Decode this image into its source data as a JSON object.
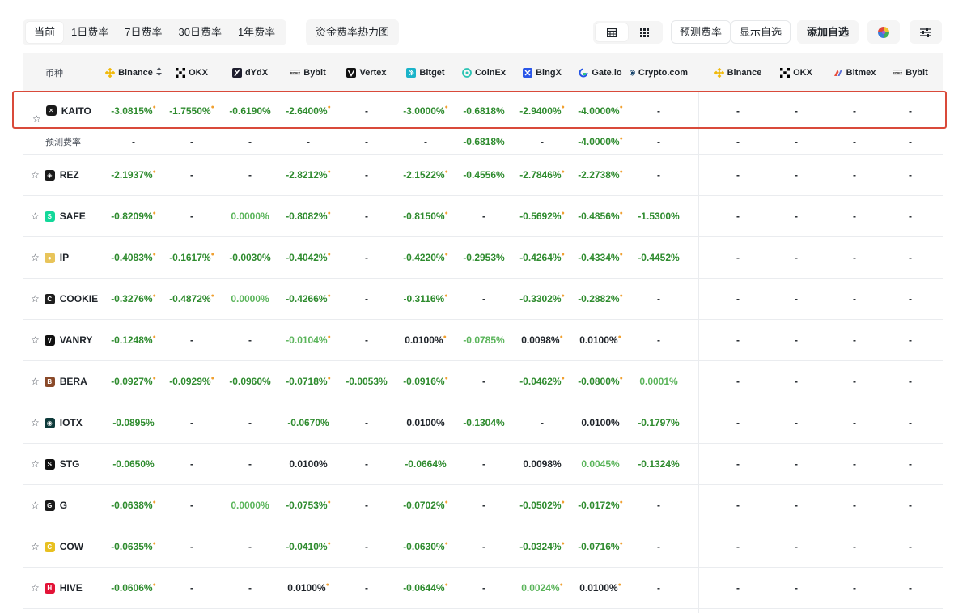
{
  "toolbar": {
    "tabs": [
      {
        "label": "当前",
        "active": true
      },
      {
        "label": "1日费率",
        "active": false
      },
      {
        "label": "7日费率",
        "active": false
      },
      {
        "label": "30日费率",
        "active": false
      },
      {
        "label": "1年费率",
        "active": false
      }
    ],
    "heatmap_label": "资金费率热力图",
    "views": [
      {
        "icon": "table-icon",
        "active": true
      },
      {
        "icon": "grid-icon",
        "active": false
      }
    ],
    "predicted_label": "预测费率",
    "show_watchlist_label": "显示自选",
    "add_watchlist_label": "添加自选",
    "color_icon": "palette-icon",
    "settings_icon": "sliders-icon"
  },
  "colors": {
    "negative": "#2e8b2e",
    "negative_light": "#5ab45a",
    "positive": "#1e2329",
    "dot": "#f0a030",
    "highlight": "#d94a3a",
    "header_bg": "#f5f5f5"
  },
  "table": {
    "coin_header": "币种",
    "exchanges": [
      {
        "name": "Binance",
        "icon": "binance-icon",
        "color": "#f0b90b",
        "sortable": true
      },
      {
        "name": "OKX",
        "icon": "okx-icon",
        "color": "#000000"
      },
      {
        "name": "dYdX",
        "icon": "dydx-icon",
        "color": "#1e1e2e"
      },
      {
        "name": "Bybit",
        "icon": "bybit-icon",
        "color": "#222222"
      },
      {
        "name": "Vertex",
        "icon": "vertex-icon",
        "color": "#111111"
      },
      {
        "name": "Bitget",
        "icon": "bitget-icon",
        "color": "#1ab3c9"
      },
      {
        "name": "CoinEx",
        "icon": "coinex-icon",
        "color": "#2bc4b4"
      },
      {
        "name": "BingX",
        "icon": "bingx-icon",
        "color": "#2a56e8"
      },
      {
        "name": "Gate.io",
        "icon": "gateio-icon",
        "color": "#2354e6"
      },
      {
        "name": "Crypto.com",
        "icon": "cryptocom-icon",
        "color": "#103f68"
      },
      {
        "name": "Binance",
        "icon": "binance-icon",
        "color": "#f0b90b"
      },
      {
        "name": "OKX",
        "icon": "okx-icon",
        "color": "#000000"
      },
      {
        "name": "Bitmex",
        "icon": "bitmex-icon",
        "color": "#e84e3c"
      },
      {
        "name": "Bybit",
        "icon": "bybit-icon",
        "color": "#222222"
      }
    ],
    "rows": [
      {
        "type": "first",
        "coin": "KAITO",
        "logo_color": "#1a1a1a",
        "logo_glyph": "✕",
        "values": [
          "-3.0815%",
          "-1.7550%",
          "-0.6190%",
          "-2.6400%",
          "-",
          "-3.0000%",
          "-0.6818%",
          "-2.9400%",
          "-4.0000%",
          "-",
          "-",
          "-",
          "-",
          "-"
        ],
        "dots": [
          1,
          1,
          0,
          1,
          0,
          1,
          0,
          1,
          1,
          0,
          0,
          0,
          0,
          0
        ],
        "light": [
          0,
          0,
          0,
          0,
          0,
          0,
          0,
          0,
          0,
          0,
          0,
          0,
          0,
          0
        ]
      },
      {
        "type": "pred",
        "label": "预测费率",
        "values": [
          "-",
          "-",
          "-",
          "-",
          "-",
          "-",
          "-0.6818%",
          "-",
          "-4.0000%",
          "-",
          "-",
          "-",
          "-",
          "-"
        ],
        "dots": [
          0,
          0,
          0,
          0,
          0,
          0,
          0,
          0,
          1,
          0,
          0,
          0,
          0,
          0
        ],
        "light": [
          0,
          0,
          0,
          0,
          0,
          0,
          0,
          0,
          0,
          0,
          0,
          0,
          0,
          0
        ]
      },
      {
        "type": "norm",
        "coin": "REZ",
        "logo_color": "#1a1a1a",
        "logo_glyph": "◈",
        "values": [
          "-2.1937%",
          "-",
          "-",
          "-2.8212%",
          "-",
          "-2.1522%",
          "-0.4556%",
          "-2.7846%",
          "-2.2738%",
          "-",
          "-",
          "-",
          "-",
          "-"
        ],
        "dots": [
          1,
          0,
          0,
          1,
          0,
          1,
          0,
          1,
          1,
          0,
          0,
          0,
          0,
          0
        ],
        "light": [
          0,
          0,
          0,
          0,
          0,
          0,
          0,
          0,
          0,
          0,
          0,
          0,
          0,
          0
        ]
      },
      {
        "type": "norm",
        "coin": "SAFE",
        "logo_color": "#12d89a",
        "logo_glyph": "S",
        "values": [
          "-0.8209%",
          "-",
          "0.0000%",
          "-0.8082%",
          "-",
          "-0.8150%",
          "-",
          "-0.5692%",
          "-0.4856%",
          "-1.5300%",
          "-",
          "-",
          "-",
          "-"
        ],
        "dots": [
          1,
          0,
          0,
          1,
          0,
          1,
          0,
          1,
          1,
          0,
          0,
          0,
          0,
          0
        ],
        "light": [
          0,
          0,
          1,
          0,
          0,
          0,
          0,
          0,
          0,
          0,
          0,
          0,
          0,
          0
        ]
      },
      {
        "type": "norm",
        "coin": "IP",
        "logo_color": "#e8c45a",
        "logo_glyph": "●",
        "values": [
          "-0.4083%",
          "-0.1617%",
          "-0.0030%",
          "-0.4042%",
          "-",
          "-0.4220%",
          "-0.2953%",
          "-0.4264%",
          "-0.4334%",
          "-0.4452%",
          "-",
          "-",
          "-",
          "-"
        ],
        "dots": [
          1,
          1,
          0,
          1,
          0,
          1,
          0,
          1,
          1,
          0,
          0,
          0,
          0,
          0
        ],
        "light": [
          0,
          0,
          0,
          0,
          0,
          0,
          0,
          0,
          0,
          0,
          0,
          0,
          0,
          0
        ]
      },
      {
        "type": "norm",
        "coin": "COOKIE",
        "logo_color": "#1e1e1e",
        "logo_glyph": "C",
        "values": [
          "-0.3276%",
          "-0.4872%",
          "0.0000%",
          "-0.4266%",
          "-",
          "-0.3116%",
          "-",
          "-0.3302%",
          "-0.2882%",
          "-",
          "-",
          "-",
          "-",
          "-"
        ],
        "dots": [
          1,
          1,
          0,
          1,
          0,
          1,
          0,
          1,
          1,
          0,
          0,
          0,
          0,
          0
        ],
        "light": [
          0,
          0,
          1,
          0,
          0,
          0,
          0,
          0,
          0,
          0,
          0,
          0,
          0,
          0
        ]
      },
      {
        "type": "norm",
        "coin": "VANRY",
        "logo_color": "#111111",
        "logo_glyph": "V",
        "values": [
          "-0.1248%",
          "-",
          "-",
          "-0.0104%",
          "-",
          "0.0100%",
          "-0.0785%",
          "0.0098%",
          "0.0100%",
          "-",
          "-",
          "-",
          "-",
          "-"
        ],
        "dots": [
          1,
          0,
          0,
          1,
          0,
          1,
          0,
          1,
          1,
          0,
          0,
          0,
          0,
          0
        ],
        "light": [
          0,
          0,
          0,
          1,
          0,
          0,
          1,
          0,
          0,
          0,
          0,
          0,
          0,
          0
        ]
      },
      {
        "type": "norm",
        "coin": "BERA",
        "logo_color": "#8a4a2a",
        "logo_glyph": "B",
        "values": [
          "-0.0927%",
          "-0.0929%",
          "-0.0960%",
          "-0.0718%",
          "-0.0053%",
          "-0.0916%",
          "-",
          "-0.0462%",
          "-0.0800%",
          "0.0001%",
          "-",
          "-",
          "-",
          "-"
        ],
        "dots": [
          1,
          1,
          0,
          1,
          0,
          1,
          0,
          1,
          1,
          0,
          0,
          0,
          0,
          0
        ],
        "light": [
          0,
          0,
          0,
          0,
          0,
          0,
          0,
          0,
          0,
          1,
          0,
          0,
          0,
          0
        ]
      },
      {
        "type": "norm",
        "coin": "IOTX",
        "logo_color": "#0e3a3a",
        "logo_glyph": "◉",
        "values": [
          "-0.0895%",
          "-",
          "-",
          "-0.0670%",
          "-",
          "0.0100%",
          "-0.1304%",
          "-",
          "0.0100%",
          "-0.1797%",
          "-",
          "-",
          "-",
          "-"
        ],
        "dots": [
          0,
          0,
          0,
          0,
          0,
          0,
          0,
          0,
          0,
          0,
          0,
          0,
          0,
          0
        ],
        "light": [
          0,
          0,
          0,
          0,
          0,
          0,
          0,
          0,
          0,
          0,
          0,
          0,
          0,
          0
        ]
      },
      {
        "type": "norm",
        "coin": "STG",
        "logo_color": "#111111",
        "logo_glyph": "S",
        "values": [
          "-0.0650%",
          "-",
          "-",
          "0.0100%",
          "-",
          "-0.0664%",
          "-",
          "0.0098%",
          "0.0045%",
          "-0.1324%",
          "-",
          "-",
          "-",
          "-"
        ],
        "dots": [
          0,
          0,
          0,
          0,
          0,
          0,
          0,
          0,
          0,
          0,
          0,
          0,
          0,
          0
        ],
        "light": [
          0,
          0,
          0,
          0,
          0,
          0,
          0,
          0,
          1,
          0,
          0,
          0,
          0,
          0
        ]
      },
      {
        "type": "norm",
        "coin": "G",
        "logo_color": "#1a1a1a",
        "logo_glyph": "G",
        "values": [
          "-0.0638%",
          "-",
          "0.0000%",
          "-0.0753%",
          "-",
          "-0.0702%",
          "-",
          "-0.0502%",
          "-0.0172%",
          "-",
          "-",
          "-",
          "-",
          "-"
        ],
        "dots": [
          1,
          0,
          0,
          1,
          0,
          1,
          0,
          1,
          1,
          0,
          0,
          0,
          0,
          0
        ],
        "light": [
          0,
          0,
          1,
          0,
          0,
          0,
          0,
          0,
          0,
          0,
          0,
          0,
          0,
          0
        ]
      },
      {
        "type": "norm",
        "coin": "COW",
        "logo_color": "#e8c020",
        "logo_glyph": "C",
        "values": [
          "-0.0635%",
          "-",
          "-",
          "-0.0410%",
          "-",
          "-0.0630%",
          "-",
          "-0.0324%",
          "-0.0716%",
          "-",
          "-",
          "-",
          "-",
          "-"
        ],
        "dots": [
          1,
          0,
          0,
          1,
          0,
          1,
          0,
          1,
          1,
          0,
          0,
          0,
          0,
          0
        ],
        "light": [
          0,
          0,
          0,
          0,
          0,
          0,
          0,
          0,
          0,
          0,
          0,
          0,
          0,
          0
        ]
      },
      {
        "type": "norm",
        "coin": "HIVE",
        "logo_color": "#e31337",
        "logo_glyph": "H",
        "values": [
          "-0.0606%",
          "-",
          "-",
          "0.0100%",
          "-",
          "-0.0644%",
          "-",
          "0.0024%",
          "0.0100%",
          "-",
          "-",
          "-",
          "-",
          "-"
        ],
        "dots": [
          1,
          0,
          0,
          1,
          0,
          1,
          0,
          1,
          1,
          0,
          0,
          0,
          0,
          0
        ],
        "light": [
          0,
          0,
          0,
          0,
          0,
          0,
          0,
          1,
          0,
          0,
          0,
          0,
          0,
          0
        ]
      }
    ]
  }
}
